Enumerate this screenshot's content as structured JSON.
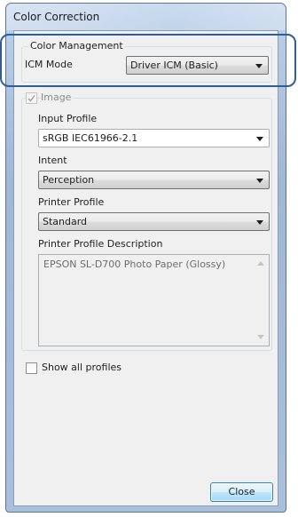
{
  "window": {
    "title": "Color Correction"
  },
  "color_management": {
    "group_label": "Color Management",
    "icm_mode_label": "ICM Mode",
    "icm_mode_value": "Driver ICM (Basic)"
  },
  "image": {
    "checkbox_label": "Image",
    "checked": true,
    "input_profile_label": "Input Profile",
    "input_profile_value": "sRGB IEC61966-2.1",
    "intent_label": "Intent",
    "intent_value": "Perception",
    "printer_profile_label": "Printer Profile",
    "printer_profile_value": "Standard",
    "printer_profile_description_label": "Printer Profile Description",
    "printer_profile_description": "EPSON SL-D700 Photo Paper (Glossy)"
  },
  "show_all_profiles": {
    "label": "Show all profiles",
    "checked": false
  },
  "buttons": {
    "close_label": "Close"
  },
  "colors": {
    "highlight": "#2d5e96",
    "title_bar": "#c3d6ec"
  }
}
